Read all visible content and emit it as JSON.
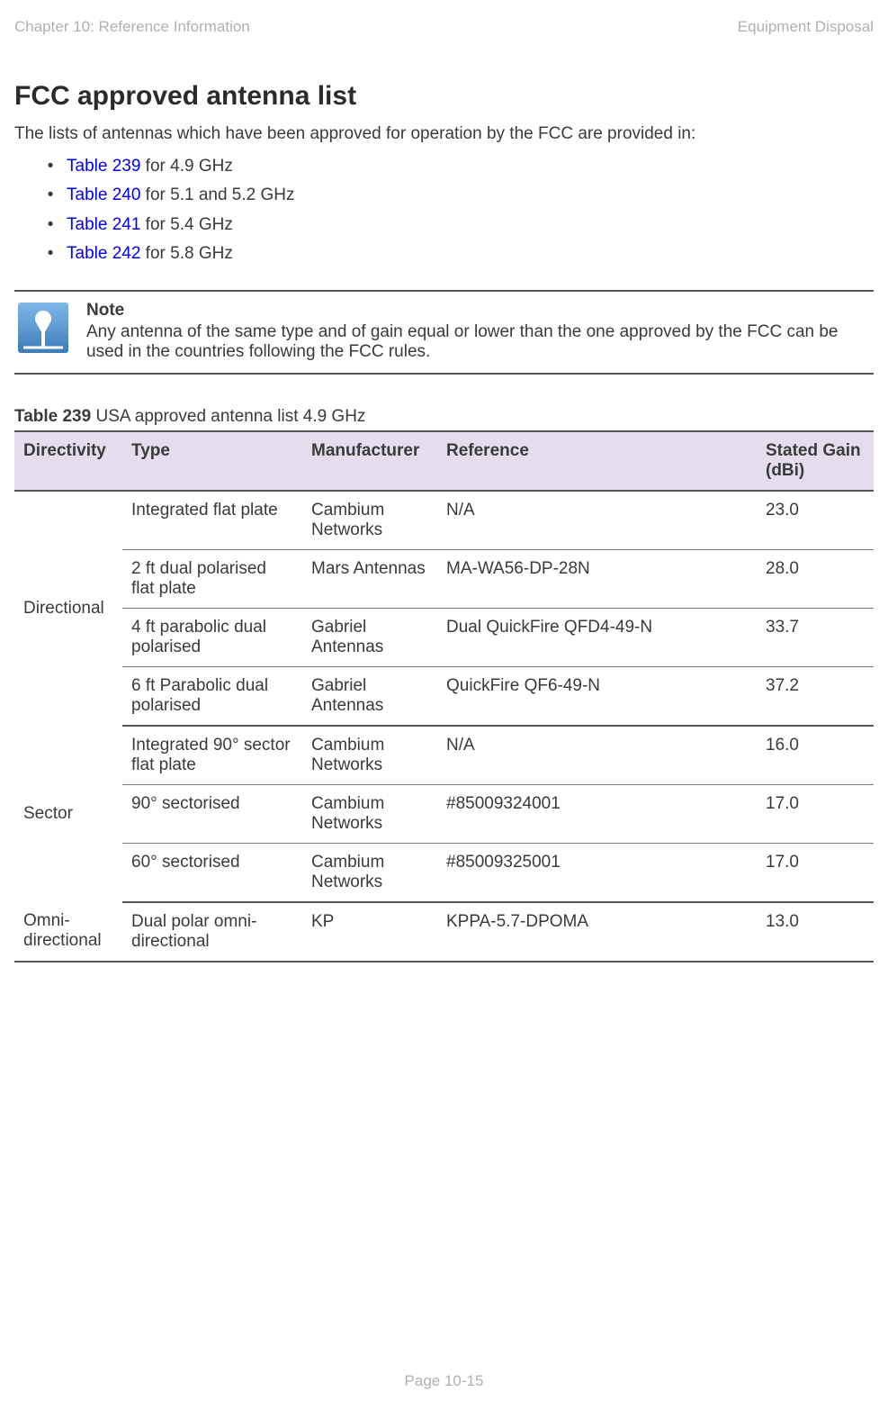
{
  "header": {
    "left": "Chapter 10:  Reference Information",
    "right": "Equipment Disposal"
  },
  "section_title": "FCC approved antenna list",
  "intro": "The lists of antennas which have been approved for operation by the FCC are provided in:",
  "bullets": [
    {
      "link": "Table 239",
      "rest": " for 4.9 GHz"
    },
    {
      "link": "Table 240",
      "rest": " for 5.1 and 5.2 GHz"
    },
    {
      "link": "Table 241",
      "rest": " for 5.4 GHz"
    },
    {
      "link": "Table 242",
      "rest": " for 5.8 GHz"
    }
  ],
  "note": {
    "title": "Note",
    "body": "Any antenna of the same type and of gain equal or lower than the one approved by the FCC can be used in the countries following the FCC rules."
  },
  "table239": {
    "label": "Table 239",
    "caption": " USA approved antenna list 4.9 GHz",
    "headers": {
      "directivity": "Directivity",
      "type": "Type",
      "manufacturer": "Manufacturer",
      "reference": "Reference",
      "gain": "Stated Gain (dBi)"
    },
    "groups": [
      {
        "directivity": "Directional",
        "rows": [
          {
            "type": "Integrated flat plate",
            "manufacturer": "Cambium Networks",
            "reference": "N/A",
            "gain": "23.0"
          },
          {
            "type": "2 ft dual polarised flat plate",
            "manufacturer": "Mars Antennas",
            "reference": "MA-WA56-DP-28N",
            "gain": "28.0"
          },
          {
            "type": "4 ft parabolic dual polarised",
            "manufacturer": "Gabriel Antennas",
            "reference": "Dual QuickFire QFD4-49-N",
            "gain": "33.7"
          },
          {
            "type": "6 ft Parabolic dual polarised",
            "manufacturer": "Gabriel Antennas",
            "reference": "QuickFire QF6-49-N",
            "gain": "37.2"
          }
        ]
      },
      {
        "directivity": "Sector",
        "rows": [
          {
            "type": "Integrated 90° sector flat plate",
            "manufacturer": "Cambium Networks",
            "reference": "N/A",
            "gain": "16.0"
          },
          {
            "type": "90° sectorised",
            "manufacturer": "Cambium Networks",
            "reference": "#85009324001",
            "gain": "17.0"
          },
          {
            "type": "60° sectorised",
            "manufacturer": "Cambium Networks",
            "reference": "#85009325001",
            "gain": "17.0"
          }
        ]
      },
      {
        "directivity": "Omni-directional",
        "rows": [
          {
            "type": "Dual polar omni-directional",
            "manufacturer": "KP",
            "reference": "KPPA-5.7-DPOMA",
            "gain": "13.0"
          }
        ]
      }
    ]
  },
  "footer": "Page 10-15"
}
